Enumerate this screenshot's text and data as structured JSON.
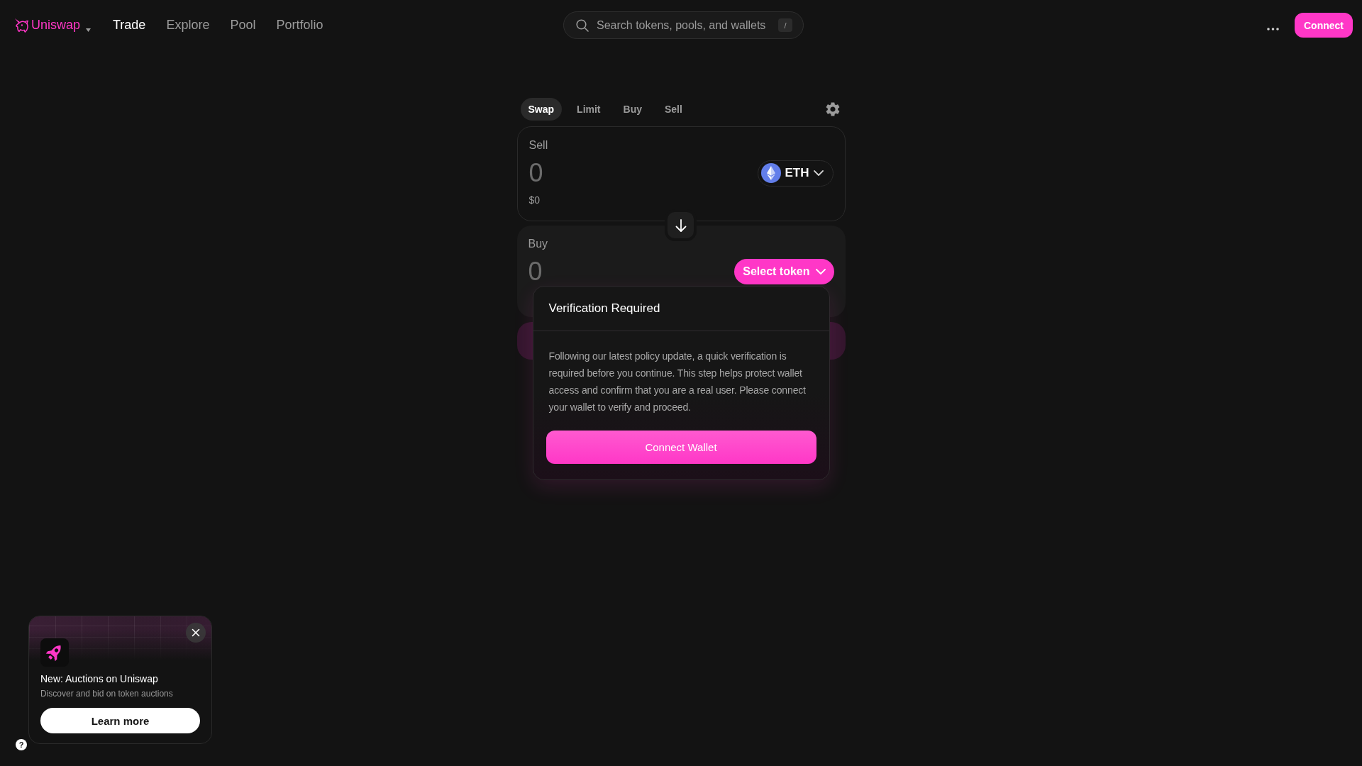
{
  "nav": {
    "brand": "Uniswap",
    "links": [
      {
        "label": "Trade",
        "selected": true
      },
      {
        "label": "Explore",
        "selected": false
      },
      {
        "label": "Pool",
        "selected": false
      },
      {
        "label": "Portfolio",
        "selected": false
      }
    ],
    "search": {
      "placeholder": "Search tokens, pools, and wallets",
      "shortcut": "/"
    },
    "connect_button": "Connect"
  },
  "swap": {
    "tabs": [
      {
        "label": "Swap",
        "selected": true
      },
      {
        "label": "Limit",
        "selected": false
      },
      {
        "label": "Buy",
        "selected": false
      },
      {
        "label": "Sell",
        "selected": false
      }
    ],
    "sell": {
      "label": "Sell",
      "amount": {
        "placeholder": "0"
      },
      "usd_value": "$0",
      "token": "ETH"
    },
    "buy": {
      "label": "Buy",
      "amount": {
        "placeholder": "0"
      },
      "select_button": "Select token"
    }
  },
  "verification_dialog": {
    "title": "Verification Required",
    "message": "Following our latest policy update, a quick verification is required before you continue. This step helps protect wallet access and confirm that you are a real user. Please connect your wallet to verify and proceed.",
    "button": "Connect Wallet"
  },
  "promo": {
    "title": "New: Auctions on Uniswap",
    "description": "Discover and bid on token auctions",
    "button": "Learn more"
  },
  "help_button": "?"
}
